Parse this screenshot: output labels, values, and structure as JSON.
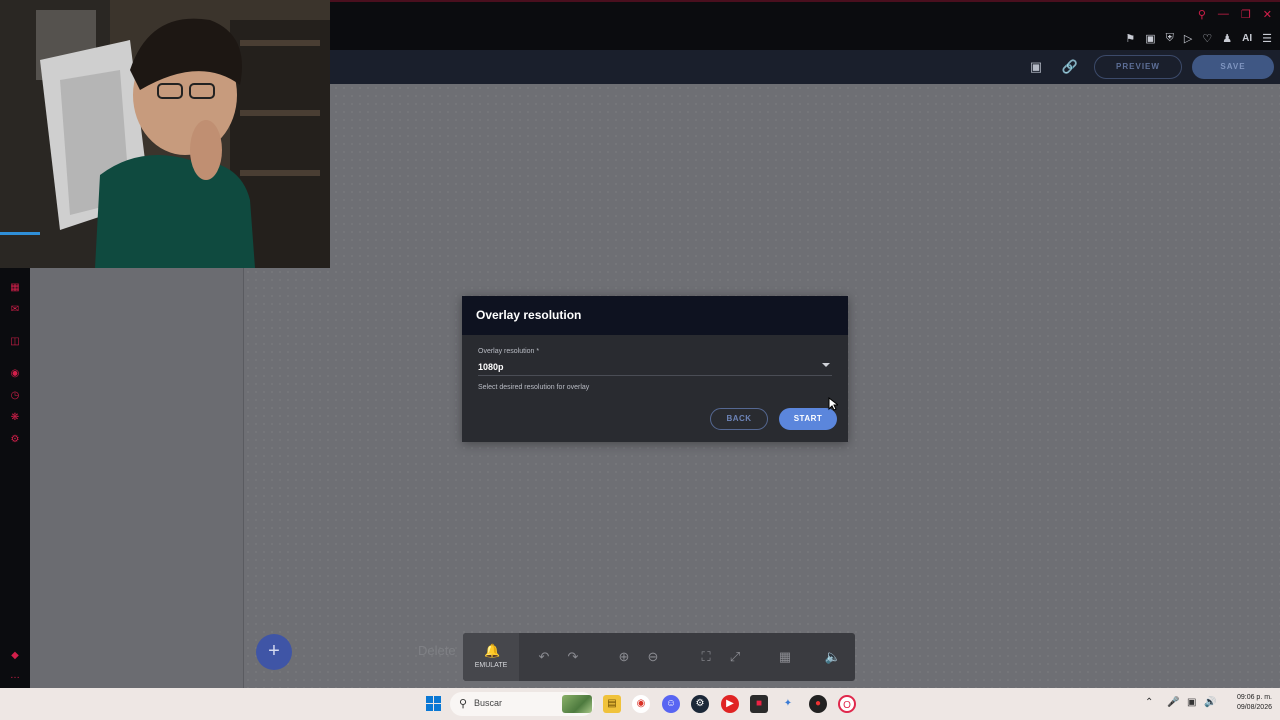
{
  "app": {
    "preview_label": "PREVIEW",
    "save_label": "SAVE"
  },
  "browser": {
    "toolbar_ai_label": "AI"
  },
  "modal": {
    "title": "Overlay resolution",
    "field_label": "Overlay resolution *",
    "selected_value": "1080p",
    "helper_text": "Select desired resolution for overlay",
    "back_label": "BACK",
    "start_label": "START"
  },
  "canvas": {
    "ghost_text": "Delete"
  },
  "bottom_toolbar": {
    "emulate_label": "EMULATE"
  },
  "taskbar": {
    "search_placeholder": "Buscar",
    "time": "09:06 p. m.",
    "date": "09/08/2026"
  },
  "colors": {
    "accent_blue": "#5b86dc",
    "header_navy": "#0e1220",
    "browser_red": "#d21f4a"
  }
}
